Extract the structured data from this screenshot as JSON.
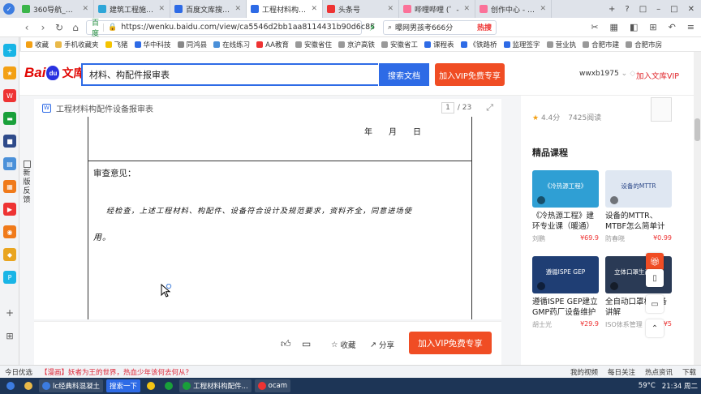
{
  "tabs": [
    {
      "label": "360导航_一个主",
      "color": "#3bb54a"
    },
    {
      "label": "建筑工程施工能",
      "color": "#2ea6d8"
    },
    {
      "label": "百度文库搜索 -",
      "color": "#2e6be6"
    },
    {
      "label": "工程材料构配件",
      "color": "#2e6be6",
      "active": true
    },
    {
      "label": "头条号",
      "color": "#e33"
    },
    {
      "label": "哔哩哔哩 (゜-",
      "color": "#fb7299"
    },
    {
      "label": "创作中心 - 哔哩",
      "color": "#fb7299"
    }
  ],
  "tab_tools": [
    "+",
    "?",
    "□",
    "–",
    "□",
    "✕"
  ],
  "address": {
    "site_label": "百度",
    "url": "https://wenku.baidu.com/view/ca5546d2bb1aa8114431b90d6c85",
    "hot_search": "曝网男孩考666分",
    "hot_label": "热搜"
  },
  "bookmarks": [
    "收藏",
    "手机收藏夹",
    "飞猪",
    "华中科技",
    "同鸿县",
    "在线练习",
    "AA教育",
    "安徽省住",
    "京沪高铁",
    "安徽省工",
    "课程表",
    "《铁路桥",
    "监理签字",
    "营业执",
    "合肥市建",
    "合肥市房"
  ],
  "header": {
    "logo_bai": "Bai",
    "logo_du": "du",
    "logo_wenku": "文库",
    "search_value": "材料、构配件报审表",
    "search_button": "搜索文档",
    "vip_button": "加入VIP免费专享",
    "username": "wwxb1975",
    "join_vip": "加入文库VIP"
  },
  "doc": {
    "title": "工程材料构配件设备报审表",
    "page_current": "1",
    "page_total": "/ 23",
    "date_year": "年",
    "date_month": "月",
    "date_day": "日",
    "review_label": "审查意见：",
    "hand_line1": "经检查，上述工程材料、构配件、设备符合设计及规范要求，资料齐全，同意进场使",
    "hand_line2": "用。",
    "feedback": [
      "新",
      "版",
      "反",
      "馈"
    ]
  },
  "bottom_bar": {
    "collect": "收藏",
    "share": "分享",
    "vip_button": "加入VIP免费专享"
  },
  "right_panel": {
    "rating": "4.4分",
    "reads": "7425阅读",
    "section_title": "精品课程",
    "courses": [
      {
        "thumb_text": "《冷热源工程》",
        "title": "《冷热源工程》建环专业课（暖通）",
        "author": "刘鹏",
        "price": "¥69.9",
        "color": "#2f9fd4"
      },
      {
        "thumb_text": "设备的MTTR",
        "title": "设备的MTTR、MTBF怎么简单计算",
        "author": "防春晓",
        "price": "¥0.99",
        "color": "#dfe7f2"
      },
      {
        "thumb_text": "遵循ISPE GEP",
        "title": "遵循ISPE GEP建立GMP药厂设备维护",
        "author": "胡士光",
        "price": "¥29.9",
        "color": "#1f3e74"
      },
      {
        "thumb_text": "立体口罩生产流程",
        "title": "全自动口罩机设备讲解",
        "author": "ISO体系管理",
        "price": "¥5",
        "color": "#2a3a55"
      }
    ]
  },
  "statusbar": {
    "weather": "今日优选",
    "news": "【漫画】妖者为王的世界，热血少年该何去何从？",
    "items": [
      "我的视频",
      "每日关注",
      "热点资讯",
      "下载"
    ]
  },
  "taskbar": {
    "items": [
      "lc经典科混凝土",
      "搜索一下",
      "工程材料构配件...",
      "ocam"
    ],
    "temp": "59°C",
    "time": "21:34 周二"
  }
}
